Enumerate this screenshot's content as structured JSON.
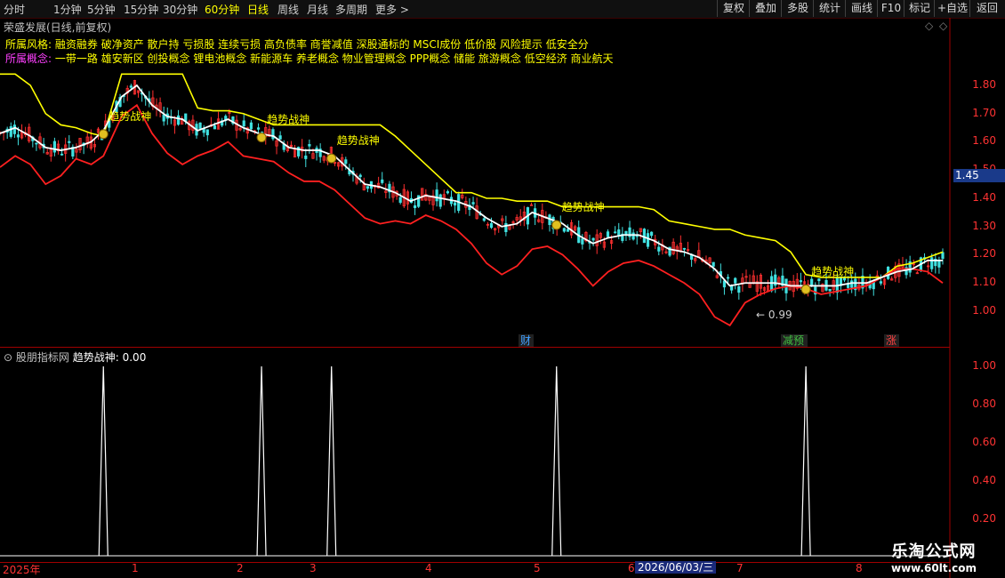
{
  "toolbar": {
    "timeframes": [
      "分时",
      "1分钟",
      "5分钟",
      "15分钟",
      "30分钟",
      "60分钟",
      "日线",
      "周线",
      "月线",
      "多周期",
      "更多 >"
    ],
    "active": "日线",
    "right_buttons": [
      "复权",
      "叠加",
      "多股",
      "统计",
      "画线",
      "F10",
      "标记",
      "+自选",
      "返回"
    ]
  },
  "panel_title": "荣盛发展(日线,前复权)",
  "info": {
    "style_label": "所属风格:",
    "style_text": "融资融券 破净资产 散户持 亏损股 连续亏损 高负债率 商誉减值 深股通标的 MSCI成份 低价股 风险提示 低安全分",
    "concept_label": "所属概念:",
    "concept_text": "一带一路 雄安新区 创投概念 锂电池概念 新能源车 养老概念 物业管理概念 PPP概念 储能 旅游概念 低空经济 商业航天"
  },
  "price_axis": [
    "1.80",
    "1.70",
    "1.60",
    "1.50",
    "1.40",
    "1.30",
    "1.20",
    "1.10",
    "1.00"
  ],
  "current_price": "1.45",
  "low_label": "0.99",
  "event_markers": [
    "财",
    "减预",
    "涨"
  ],
  "signal_label": "趋势战神",
  "indicator": {
    "title": "股朋指标网",
    "name": "趋势战神:",
    "value": "0.00",
    "axis": [
      "1.00",
      "0.80",
      "0.60",
      "0.40",
      "0.20"
    ]
  },
  "date_axis": {
    "labels": [
      "2025年",
      "1",
      "2",
      "3",
      "4",
      "5",
      "6",
      "7",
      "8"
    ],
    "cursor_date": "2026/06/03/三"
  },
  "watermark": {
    "line1": "乐淘公式网",
    "line2": "www.60lt.com"
  },
  "colors": {
    "upper_band": "#ffff00",
    "mid_line": "#ffffff",
    "lower_band": "#ff2020",
    "up_candle": "#ff3030",
    "down_candle": "#40e0e0"
  },
  "chart_data": {
    "type": "line",
    "title": "荣盛发展(日线,前复权)",
    "ylim": [
      0.93,
      1.93
    ],
    "price": {
      "x": [
        0,
        5,
        10,
        15,
        20,
        25,
        30,
        34,
        40,
        45,
        50,
        55,
        60,
        65,
        70,
        75,
        80,
        85,
        90,
        95,
        100,
        105,
        110,
        115,
        120,
        125,
        130,
        135,
        140,
        145,
        150,
        155,
        160,
        165,
        170,
        175,
        180,
        185,
        190,
        195,
        200,
        205,
        210,
        215,
        220,
        225,
        230,
        235,
        240,
        245,
        250,
        255,
        260,
        265,
        270,
        275,
        280,
        285,
        290,
        295,
        300,
        305,
        310
      ],
      "upper": [
        1.84,
        1.84,
        1.8,
        1.7,
        1.66,
        1.65,
        1.63,
        1.62,
        1.84,
        1.84,
        1.84,
        1.84,
        1.84,
        1.72,
        1.71,
        1.71,
        1.7,
        1.68,
        1.66,
        1.66,
        1.66,
        1.66,
        1.66,
        1.66,
        1.66,
        1.66,
        1.62,
        1.57,
        1.52,
        1.47,
        1.42,
        1.42,
        1.4,
        1.4,
        1.39,
        1.39,
        1.39,
        1.37,
        1.37,
        1.37,
        1.37,
        1.37,
        1.37,
        1.36,
        1.32,
        1.31,
        1.3,
        1.29,
        1.29,
        1.27,
        1.26,
        1.25,
        1.21,
        1.13,
        1.12,
        1.12,
        1.12,
        1.12,
        1.12,
        1.16,
        1.17,
        1.19,
        1.21
      ],
      "mid": [
        1.63,
        1.65,
        1.62,
        1.58,
        1.57,
        1.58,
        1.6,
        1.64,
        1.76,
        1.8,
        1.73,
        1.69,
        1.68,
        1.64,
        1.66,
        1.68,
        1.65,
        1.63,
        1.62,
        1.58,
        1.57,
        1.57,
        1.55,
        1.5,
        1.45,
        1.44,
        1.42,
        1.39,
        1.41,
        1.4,
        1.39,
        1.37,
        1.33,
        1.3,
        1.31,
        1.35,
        1.33,
        1.31,
        1.27,
        1.24,
        1.26,
        1.27,
        1.27,
        1.25,
        1.22,
        1.21,
        1.19,
        1.15,
        1.09,
        1.1,
        1.1,
        1.1,
        1.09,
        1.09,
        1.09,
        1.09,
        1.1,
        1.1,
        1.12,
        1.14,
        1.15,
        1.18,
        1.18
      ],
      "lower": [
        1.51,
        1.55,
        1.52,
        1.45,
        1.48,
        1.54,
        1.52,
        1.55,
        1.69,
        1.73,
        1.63,
        1.56,
        1.52,
        1.55,
        1.57,
        1.6,
        1.55,
        1.54,
        1.53,
        1.49,
        1.46,
        1.46,
        1.43,
        1.38,
        1.33,
        1.31,
        1.32,
        1.31,
        1.34,
        1.32,
        1.29,
        1.24,
        1.17,
        1.13,
        1.16,
        1.22,
        1.23,
        1.2,
        1.15,
        1.09,
        1.14,
        1.17,
        1.18,
        1.16,
        1.13,
        1.1,
        1.06,
        0.98,
        0.95,
        1.03,
        1.06,
        1.08,
        1.09,
        1.08,
        1.06,
        1.07,
        1.08,
        1.09,
        1.12,
        1.15,
        1.15,
        1.14,
        1.1
      ]
    },
    "signals": [
      {
        "x": 34,
        "value": 1.0
      },
      {
        "x": 86,
        "value": 1.0
      },
      {
        "x": 109,
        "value": 1.0
      },
      {
        "x": 183,
        "value": 1.0
      },
      {
        "x": 265,
        "value": 1.0
      }
    ],
    "indicator_ylim": [
      0.0,
      1.08
    ],
    "indicator_length": 280
  }
}
